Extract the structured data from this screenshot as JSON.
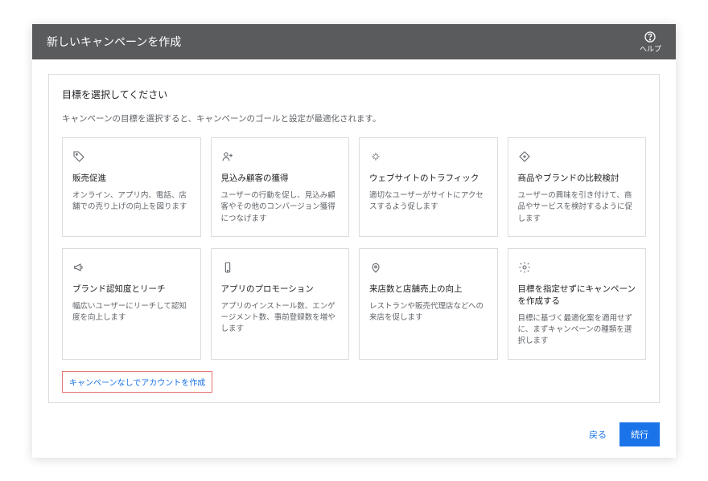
{
  "header": {
    "title": "新しいキャンペーンを作成",
    "help_label": "ヘルプ"
  },
  "panel": {
    "title": "目標を選択してください",
    "subtitle": "キャンペーンの目標を選択すると、キャンペーンのゴールと設定が最適化されます。"
  },
  "cards": [
    {
      "icon": "tag-icon",
      "title": "販売促進",
      "desc": "オンライン、アプリ内、電話、店舗での売り上げの向上を図ります"
    },
    {
      "icon": "person-add-icon",
      "title": "見込み顧客の獲得",
      "desc": "ユーザーの行動を促し、見込み顧客やその他のコンバージョン獲得につなげます"
    },
    {
      "icon": "sparkle-icon",
      "title": "ウェブサイトのトラフィック",
      "desc": "適切なユーザーがサイトにアクセスするよう促します"
    },
    {
      "icon": "plus-diamond-icon",
      "title": "商品やブランドの比較検討",
      "desc": "ユーザーの興味を引き付けて、商品やサービスを検討するように促します"
    },
    {
      "icon": "megaphone-icon",
      "title": "ブランド認知度とリーチ",
      "desc": "幅広いユーザーにリーチして認知度を向上します"
    },
    {
      "icon": "app-icon",
      "title": "アプリのプロモーション",
      "desc": "アプリのインストール数、エンゲージメント数、事前登録数を増やします"
    },
    {
      "icon": "location-icon",
      "title": "来店数と店舗売上の向上",
      "desc": "レストランや販売代理店などへの来店を促します"
    },
    {
      "icon": "gear-icon",
      "title": "目標を指定せずにキャンペーンを作成する",
      "desc": "目標に基づく最適化案を適用せずに、まずキャンペーンの種類を選択します"
    }
  ],
  "link": {
    "no_campaign": "キャンペーンなしでアカウントを作成"
  },
  "footer": {
    "back": "戻る",
    "next": "続行"
  }
}
